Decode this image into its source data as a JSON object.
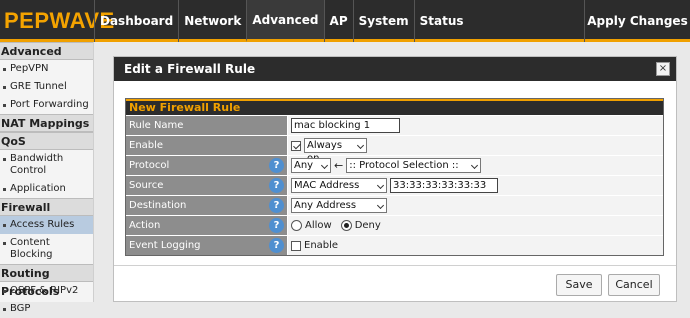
{
  "brand": "PEPWAVE",
  "nav": [
    "Dashboard",
    "Network",
    "Advanced",
    "AP",
    "System",
    "Status"
  ],
  "nav_active": "Advanced",
  "apply_label": "Apply Changes",
  "sidebar": {
    "advanced": "Advanced",
    "pepvpn": "PepVPN",
    "gre": "GRE Tunnel",
    "portfwd": "Port Forwarding",
    "nat": "NAT Mappings",
    "qos": "QoS",
    "bandwidth": "Bandwidth Control",
    "application": "Application",
    "firewall": "Firewall",
    "access_rules": "Access Rules",
    "content_blocking": "Content Blocking",
    "routing": "Routing Protocols",
    "ospf": "OSPF & RIPv2",
    "bgp": "BGP"
  },
  "dialog": {
    "title": "Edit a Firewall Rule",
    "close": "×",
    "section": "New Firewall Rule",
    "rule_name_label": "Rule Name",
    "rule_name_value": "mac blocking 1",
    "enable_label": "Enable",
    "enable_checked": true,
    "enable_schedule": "Always on",
    "protocol_label": "Protocol",
    "protocol_value": "Any",
    "protocol_arrow": "←",
    "protocol_selection": ":: Protocol Selection ::",
    "source_label": "Source",
    "source_type": "MAC Address",
    "source_value": "33:33:33:33:33:33",
    "destination_label": "Destination",
    "destination_value": "Any Address",
    "action_label": "Action",
    "action_allow": "Allow",
    "action_deny": "Deny",
    "action_selected": "Deny",
    "logging_label": "Event Logging",
    "logging_enable": "Enable",
    "logging_checked": false,
    "help": "?",
    "save": "Save",
    "cancel": "Cancel"
  },
  "colors": {
    "accent": "#f0a000",
    "header_bg": "#2c2c2c",
    "label_bg": "#8d8d8d",
    "help_bg": "#4f8fd0",
    "active_sidebar": "#b8cbe0"
  },
  "icons": [
    "close-icon",
    "help-icon",
    "chevron-down-icon",
    "arrow-left-icon",
    "checkbox-icon",
    "radio-icon"
  ]
}
